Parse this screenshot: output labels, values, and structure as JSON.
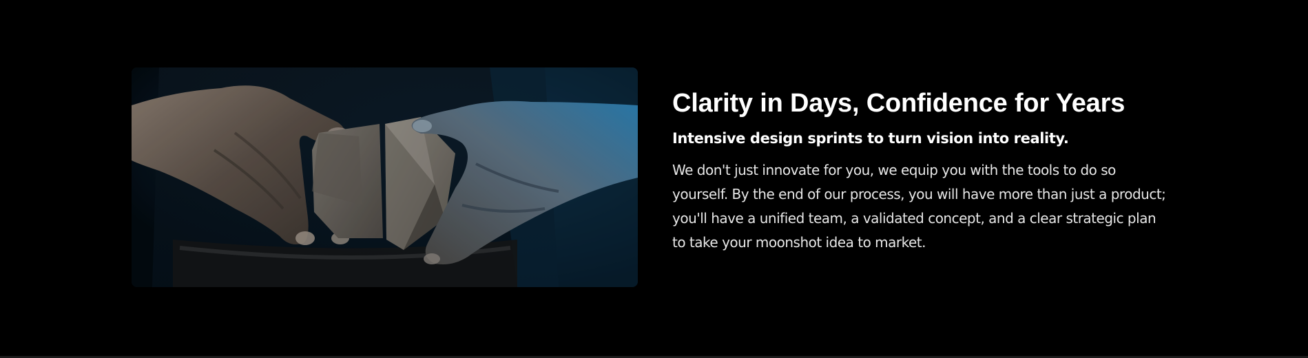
{
  "feature": {
    "image": {
      "subject": "hands-holding-clay-geometric-form",
      "colors": {
        "background_dark": "#05101a",
        "blue_glow": "#1a86c8",
        "clay": "#6f6a63",
        "skin": "#6a5e55"
      }
    },
    "headline": "Clarity in Days, Confidence for Years",
    "subheadline": "Intensive design sprints to turn vision into reality.",
    "body": "We don't just innovate for you, we equip you with the tools to do so yourself. By the end of our process, you will have more than just a product; you'll have a unified team, a validated concept, and a clear strategic plan to take your moonshot idea to market."
  },
  "theme": {
    "background": "#000000",
    "text": "#ffffff",
    "body_text": "#e8e8e8"
  }
}
